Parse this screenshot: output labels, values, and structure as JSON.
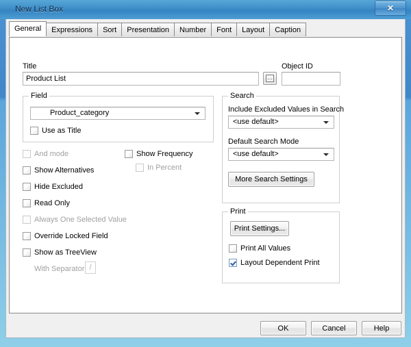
{
  "window": {
    "title": "New List Box",
    "close_label": "✖"
  },
  "tabs": [
    {
      "label": "General",
      "active": true
    },
    {
      "label": "Expressions",
      "active": false
    },
    {
      "label": "Sort",
      "active": false
    },
    {
      "label": "Presentation",
      "active": false
    },
    {
      "label": "Number",
      "active": false
    },
    {
      "label": "Font",
      "active": false
    },
    {
      "label": "Layout",
      "active": false
    },
    {
      "label": "Caption",
      "active": false
    }
  ],
  "general": {
    "title_label": "Title",
    "title_value": "Product List",
    "title_placeholder": "",
    "ellipsis_label": "...",
    "object_id_label": "Object ID",
    "object_id_value": "",
    "object_id_placeholder": "",
    "field_group_title": "Field",
    "field_combo_value": "Product_category",
    "use_as_title_label": "Use as Title",
    "checkboxes_left": [
      {
        "label": "And mode",
        "checked": false,
        "disabled": true
      },
      {
        "label": "Show Alternatives",
        "checked": false,
        "disabled": false
      },
      {
        "label": "Hide Excluded",
        "checked": false,
        "disabled": false
      },
      {
        "label": "Read Only",
        "checked": false,
        "disabled": false
      },
      {
        "label": "Always One Selected Value",
        "checked": false,
        "disabled": true
      },
      {
        "label": "Override Locked Field",
        "checked": false,
        "disabled": false
      },
      {
        "label": "Show as TreeView",
        "checked": false,
        "disabled": false
      }
    ],
    "show_frequency_label": "Show Frequency",
    "in_percent_label": "In Percent",
    "with_separator_label": "With Separator",
    "with_separator_value": "/"
  },
  "search": {
    "group_title": "Search",
    "include_excluded_label": "Include Excluded Values in Search",
    "include_excluded_value": "<use default>",
    "default_search_mode_label": "Default Search Mode",
    "default_search_mode_value": "<use default>",
    "more_search_settings_label": "More Search Settings"
  },
  "print": {
    "group_title": "Print",
    "print_settings_label": "Print Settings...",
    "print_all_values_label": "Print All Values",
    "layout_dependent_label": "Layout Dependent Print"
  },
  "footer": {
    "ok_label": "OK",
    "cancel_label": "Cancel",
    "help_label": "Help"
  },
  "colors": {
    "titlebar_blue": "#3f8dc8",
    "glass_edge": "#aee3f0",
    "dialog_bg": "#f0f0f0",
    "panel_bg": "#ffffff",
    "checkmark_blue": "#2f62a5",
    "disabled_text": "#a0a0a0"
  }
}
